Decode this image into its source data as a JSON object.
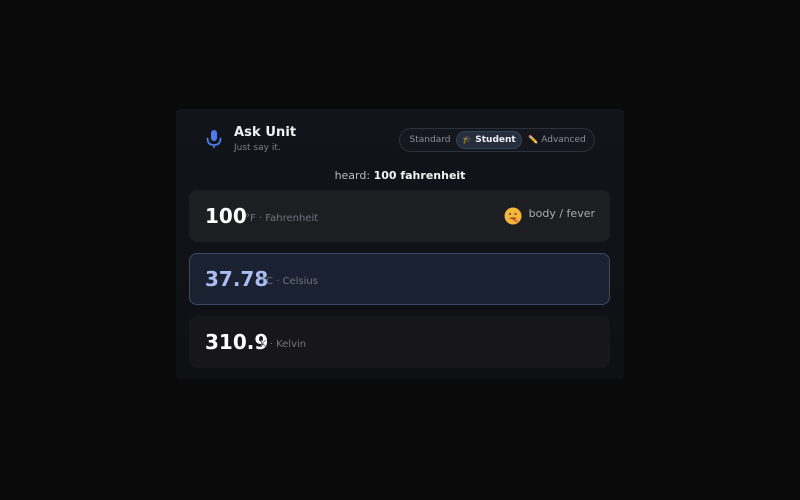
{
  "app": {
    "title": "Ask Unit",
    "subtitle": "Just say it.",
    "icon": "microphone-icon"
  },
  "modes": [
    {
      "label": "Standard",
      "active": false
    },
    {
      "label": "Student",
      "active": true,
      "icon": "graduation-cap-icon"
    },
    {
      "label": "Advanced",
      "active": false,
      "icon": "pencil-icon"
    }
  ],
  "heard": {
    "prefix": "heard:",
    "text": "100 fahrenheit"
  },
  "results": [
    {
      "value": "100",
      "unit": "°F · Fahrenheit",
      "tag": "body / fever",
      "tag_icon": "thermometer-face-icon"
    },
    {
      "value": "37.78",
      "unit": "°C · Celsius",
      "highlighted": true
    },
    {
      "value": "310.9",
      "unit": "K · Kelvin"
    }
  ],
  "colors": {
    "background": "#0a0a0b",
    "accent": "#a9bdf2",
    "mic": "#4f7be8"
  }
}
